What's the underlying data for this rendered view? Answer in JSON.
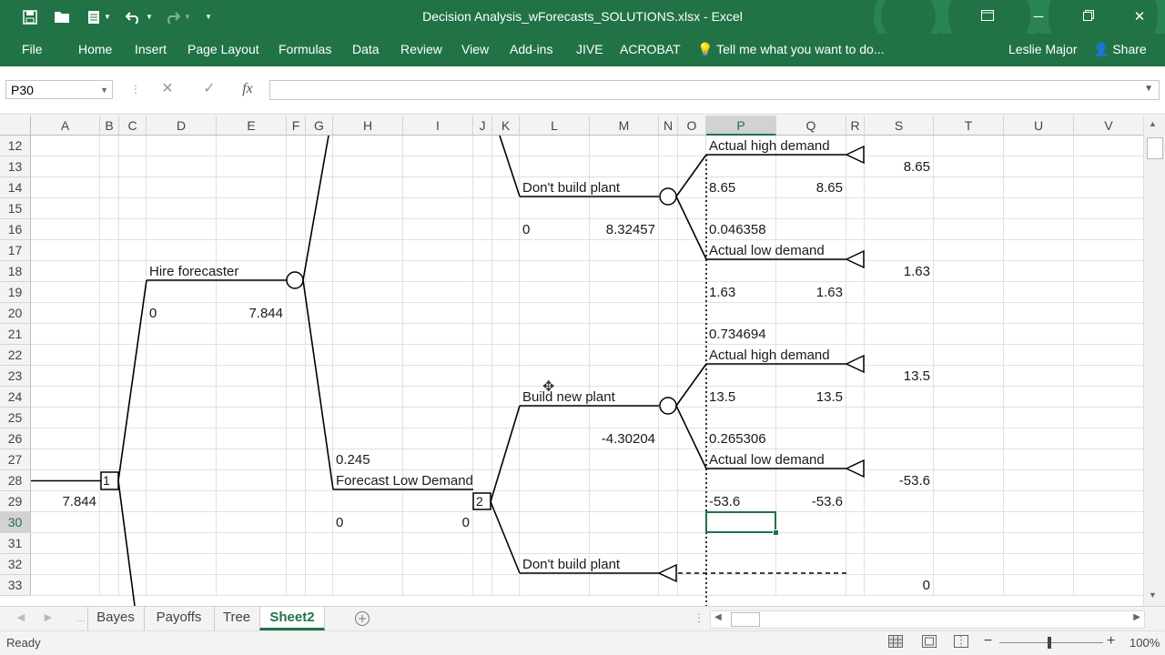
{
  "app": {
    "title": "Decision Analysis_wForecasts_SOLUTIONS.xlsx - Excel",
    "accent_color": "#217346",
    "quick_access": {
      "save_icon": "save-icon",
      "open_icon": "folder-open-icon",
      "new_icon": "new-document-icon",
      "undo_icon": "undo-icon",
      "redo_icon": "redo-icon",
      "customize_icon": "customize-qat-icon"
    },
    "window_controls": {
      "ribbon_display": "ribbon-display-icon",
      "minimize": "minimize-icon",
      "restore": "restore-icon",
      "close": "close-icon"
    }
  },
  "ribbon": {
    "tabs": [
      "File",
      "Home",
      "Insert",
      "Page Layout",
      "Formulas",
      "Data",
      "Review",
      "View",
      "Add-ins",
      "JIVE",
      "ACROBAT"
    ],
    "tell_me": "Tell me what you want to do...",
    "user": "Leslie Major",
    "share": "Share"
  },
  "formula_bar": {
    "name_box": "P30",
    "formula": ""
  },
  "columns": [
    "A",
    "B",
    "C",
    "D",
    "E",
    "F",
    "G",
    "H",
    "I",
    "J",
    "K",
    "L",
    "M",
    "N",
    "O",
    "P",
    "Q",
    "R",
    "S",
    "T",
    "U",
    "V"
  ],
  "rows": [
    "12",
    "13",
    "14",
    "15",
    "16",
    "17",
    "18",
    "19",
    "20",
    "21",
    "22",
    "23",
    "24",
    "25",
    "26",
    "27",
    "28",
    "29",
    "30",
    "31",
    "32",
    "33"
  ],
  "selected_cell": {
    "column": "P",
    "row": "30"
  },
  "cells": {
    "P12": "Actual high demand",
    "S13": "8.65",
    "L14": "Don't build plant",
    "P14": "8.65",
    "Q14": "8.65",
    "L16": "0",
    "M16": "8.32457",
    "P16": "0.046358",
    "P17": "Actual low demand",
    "D18": "Hire forecaster",
    "S18": "1.63",
    "P19": "1.63",
    "Q19": "1.63",
    "D20": "0",
    "E20": "7.844",
    "P21": "0.734694",
    "P22": "Actual high demand",
    "S23": "13.5",
    "L24": "Build new plant",
    "P24": "13.5",
    "Q24": "13.5",
    "M26": "-4.30204",
    "P26": "0.265306",
    "H27": "0.245",
    "P27": "Actual low demand",
    "H28": "Forecast Low Demand",
    "B28": "1",
    "S28": "-53.6",
    "A29": "7.844",
    "J29": "2",
    "P29": "-53.6",
    "Q29": "-53.6",
    "H30": "0",
    "I30": "0",
    "L32": "Don't build plant",
    "S33": "0"
  },
  "sheet_tabs": [
    "Bayes",
    "Payoffs",
    "Tree",
    "Sheet2"
  ],
  "active_sheet": "Sheet2",
  "add_sheet_icon": "add-sheet-icon",
  "status": {
    "text": "Ready",
    "zoom": "100%",
    "views": [
      "normal-view-icon",
      "page-layout-view-icon",
      "page-break-view-icon"
    ]
  }
}
